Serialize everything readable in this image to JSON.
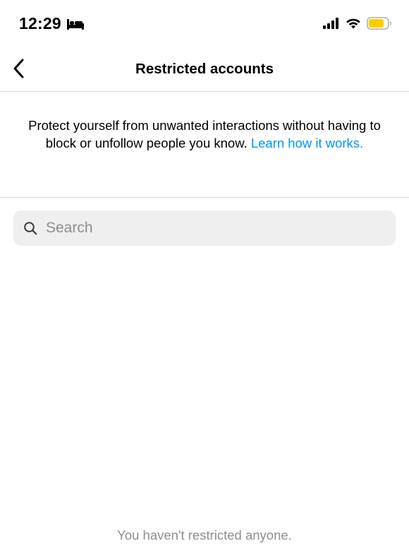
{
  "status_bar": {
    "time": "12:29",
    "icons": [
      "bed-icon",
      "signal-icon",
      "wifi-icon",
      "battery-icon"
    ],
    "battery_color": "#ffcc00"
  },
  "nav": {
    "title": "Restricted accounts",
    "back_icon": "chevron-left-icon"
  },
  "info": {
    "text": "Protect yourself from unwanted interactions without having to block or unfollow people you know. ",
    "link_text": "Learn how it works.",
    "link_color": "#0095f6"
  },
  "search": {
    "placeholder": "Search",
    "value": "",
    "icon": "search-icon"
  },
  "empty_state": {
    "message": "You haven't restricted anyone."
  }
}
